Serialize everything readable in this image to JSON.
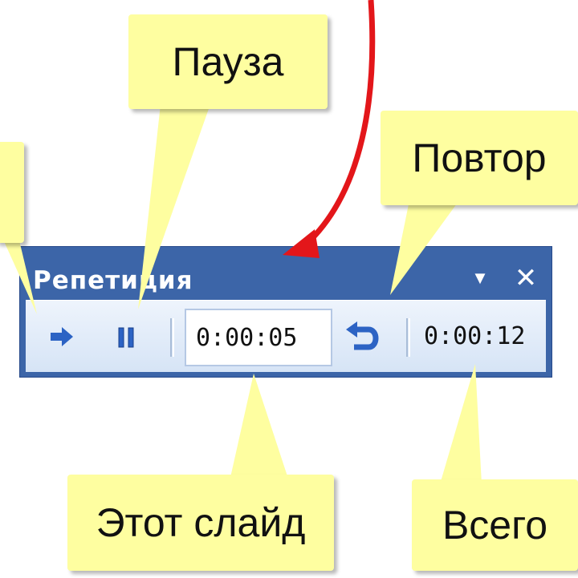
{
  "toolbar": {
    "title": "Репетиция",
    "slide_time": "0:00:05",
    "total_time": "0:00:12",
    "icons": {
      "next": "arrow-right-icon",
      "pause": "pause-icon",
      "repeat": "undo-arrow-icon",
      "menu": "dropdown-triangle-icon",
      "close": "close-icon"
    }
  },
  "callouts": {
    "pause": "Пауза",
    "repeat": "Повтор",
    "this_slide": "Этот слайд",
    "total": "Всего"
  },
  "colors": {
    "callout_fill": "#fefea0",
    "toolbar_title_bar": "#3c65a8",
    "icon_blue": "#2c63c4",
    "annotation_arrow": "#e3161a"
  }
}
